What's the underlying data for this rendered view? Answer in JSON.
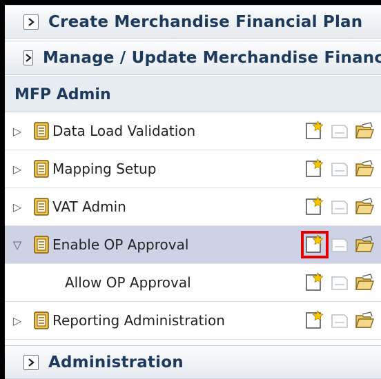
{
  "accordion": {
    "create_plan": "Create Merchandise Financial Plan",
    "manage_plan": "Manage / Update Merchandise Financial",
    "section_header": "MFP Admin",
    "administration": "Administration"
  },
  "tasks": [
    {
      "label": "Data Load Validation",
      "state": "collapsed",
      "selected": false
    },
    {
      "label": "Mapping Setup",
      "state": "collapsed",
      "selected": false
    },
    {
      "label": "VAT Admin",
      "state": "collapsed",
      "selected": false
    },
    {
      "label": "Enable OP Approval",
      "state": "expanded",
      "selected": true
    },
    {
      "label": "Allow OP Approval",
      "state": "child",
      "selected": false
    },
    {
      "label": "Reporting Administration",
      "state": "collapsed",
      "selected": false
    }
  ],
  "icons": {
    "expand": "expand-triangle-icon",
    "collapse": "collapse-triangle-icon",
    "task": "task-document-icon",
    "create": "create-workbook-icon",
    "blank": "blank-workbook-icon",
    "open": "open-workbook-icon"
  },
  "colors": {
    "header_text": "#1d3a5c",
    "selected_row": "#cdd3e5",
    "highlight": "#e00000"
  }
}
